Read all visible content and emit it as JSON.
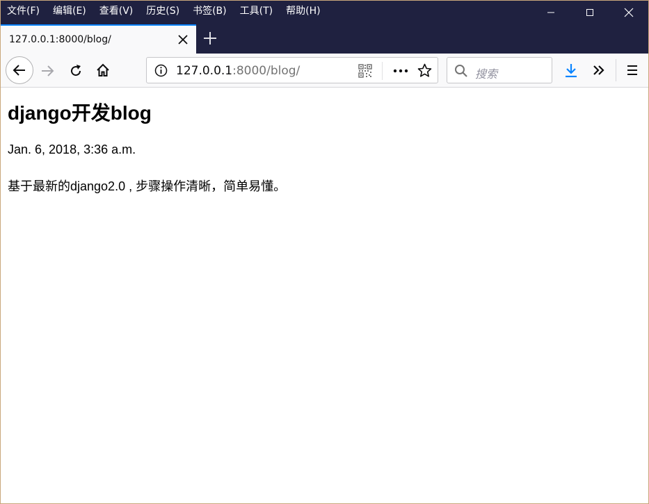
{
  "menu": {
    "items": [
      "文件(F)",
      "编辑(E)",
      "查看(V)",
      "历史(S)",
      "书签(B)",
      "工具(T)",
      "帮助(H)"
    ]
  },
  "window_controls": {
    "icons": [
      "minimize-icon",
      "maximize-icon",
      "close-icon"
    ]
  },
  "tab": {
    "title": "127.0.0.1:8000/blog/",
    "close_icon": "close-icon",
    "accent": "#0a84ff"
  },
  "newtab": {
    "icon": "plus-icon"
  },
  "navbar": {
    "url_host": "127.0.0.1",
    "url_rest": ":8000/blog/",
    "search_placeholder": "搜索",
    "icons": [
      "back-arrow-icon",
      "forward-arrow-icon",
      "reload-icon",
      "home-icon",
      "info-icon",
      "qr-code-icon",
      "more-dots-icon",
      "star-icon",
      "search-icon",
      "download-icon",
      "overflow-chevron-icon",
      "hamburger-menu-icon"
    ]
  },
  "colors": {
    "titlebar": "#1f2140",
    "download": "#0a84ff",
    "toolbar": "#f9f9fa"
  },
  "page": {
    "title": "django开发blog",
    "date": "Jan. 6, 2018, 3:36 a.m.",
    "body": "基于最新的django2.0 , 步骤操作清晰，简单易懂。"
  }
}
